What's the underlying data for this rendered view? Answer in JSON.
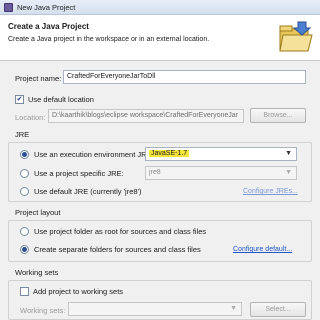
{
  "window": {
    "title": "New Java Project"
  },
  "banner": {
    "heading": "Create a Java Project",
    "description": "Create a Java project in the workspace or in an external location."
  },
  "project_name": {
    "label": "Project name:",
    "value": "CraftedForEveryoneJarToDll"
  },
  "location": {
    "use_default_label": "Use default location",
    "use_default_checked": true,
    "label": "Location:",
    "value": "D:\\kaarthik\\blogs\\eclipse workspace\\CraftedForEveryoneJar",
    "browse_label": "Browse..."
  },
  "jre": {
    "title": "JRE",
    "options": [
      {
        "label": "Use an execution environment JRE:",
        "selected": true,
        "value": "JavaSE-1.7"
      },
      {
        "label": "Use a project specific JRE:",
        "selected": false,
        "value": "jre8"
      },
      {
        "label": "Use default JRE (currently 'jre8')",
        "selected": false,
        "link": "Configure JREs..."
      }
    ]
  },
  "project_layout": {
    "title": "Project layout",
    "options": [
      {
        "label": "Use project folder as root for sources and class files",
        "selected": false
      },
      {
        "label": "Create separate folders for sources and class files",
        "selected": true,
        "link": "Configure default..."
      }
    ]
  },
  "working_sets": {
    "title": "Working sets",
    "add_label": "Add project to working sets",
    "add_checked": false,
    "label": "Working sets:",
    "value": "",
    "select_label": "Select..."
  },
  "colors": {
    "highlight": "#f4e53b",
    "link": "#1f56c8"
  }
}
